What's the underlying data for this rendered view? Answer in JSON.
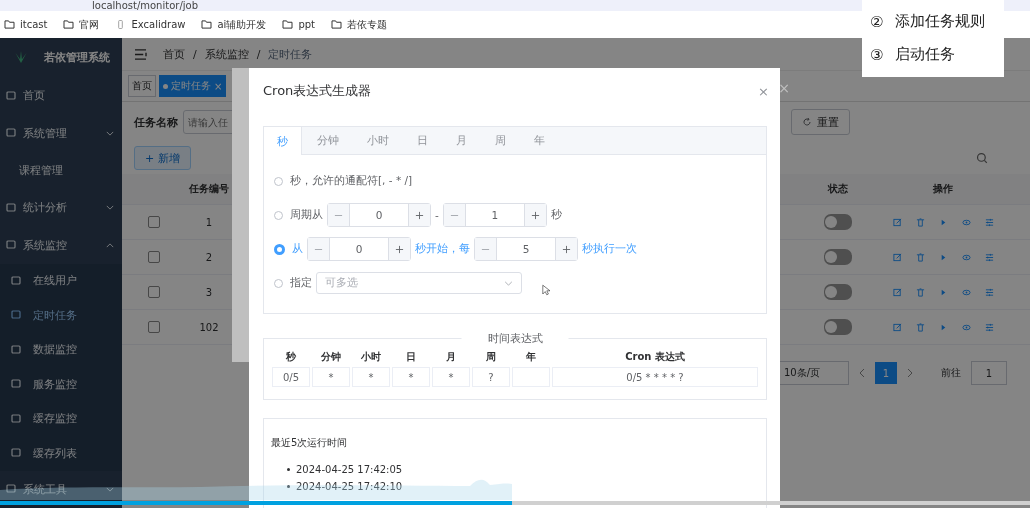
{
  "browser": {
    "url": "localhost/monitor/job",
    "bookmarks": [
      {
        "label": "itcast",
        "kind": "folder"
      },
      {
        "label": "官网",
        "kind": "folder"
      },
      {
        "label": "Excalidraw",
        "kind": "page"
      },
      {
        "label": "ai辅助开发",
        "kind": "folder"
      },
      {
        "label": "ppt",
        "kind": "folder"
      },
      {
        "label": "若依专题",
        "kind": "folder"
      }
    ]
  },
  "steps_popup": {
    "items": [
      {
        "number": "②",
        "label": "添加任务规则"
      },
      {
        "number": "③",
        "label": "启动任务"
      }
    ]
  },
  "sidebar": {
    "title": "若依管理系统",
    "items": [
      {
        "label": "首页",
        "kind": "link",
        "selected": false
      },
      {
        "label": "系统管理",
        "kind": "group",
        "expanded": false
      },
      {
        "label": "课程管理",
        "kind": "plain",
        "selected": false
      },
      {
        "label": "统计分析",
        "kind": "group",
        "expanded": false
      },
      {
        "label": "系统监控",
        "kind": "group",
        "expanded": true,
        "children": [
          {
            "label": "在线用户",
            "selected": false
          },
          {
            "label": "定时任务",
            "selected": true
          },
          {
            "label": "数据监控",
            "selected": false
          },
          {
            "label": "服务监控",
            "selected": false
          },
          {
            "label": "缓存监控",
            "selected": false
          },
          {
            "label": "缓存列表",
            "selected": false
          }
        ]
      },
      {
        "label": "系统工具",
        "kind": "group",
        "expanded": false
      }
    ]
  },
  "navbar": {
    "breadcrumb": [
      "首页",
      "系统监控",
      "定时任务"
    ],
    "separator": "/"
  },
  "tags": [
    {
      "label": "首页",
      "selected": false
    },
    {
      "label": "定时任务",
      "selected": true,
      "close": "×"
    }
  ],
  "search": {
    "label": "任务名称",
    "placeholder": "请输入任"
  },
  "add_button": "+ 新增",
  "reset_button": "重置",
  "table": {
    "columns": [
      "任务编号",
      "状态",
      "操作"
    ],
    "rows": [
      {
        "id": "1",
        "checked": false,
        "on": false
      },
      {
        "id": "2",
        "checked": false,
        "on": false
      },
      {
        "id": "3",
        "checked": false,
        "on": false
      },
      {
        "id": "102",
        "checked": false,
        "on": false
      }
    ]
  },
  "pagination": {
    "page_size": "10条/页",
    "pages": [
      {
        "label": "1",
        "selected": true
      }
    ],
    "goto_label": "前往",
    "goto_value": "1"
  },
  "back_dialog": {
    "close": "×"
  },
  "dialog": {
    "title": "Cron表达式生成器",
    "close": "×",
    "tabs": [
      {
        "label": "秒",
        "selected": true
      },
      {
        "label": "分钟",
        "selected": false
      },
      {
        "label": "小时",
        "selected": false
      },
      {
        "label": "日",
        "selected": false
      },
      {
        "label": "月",
        "selected": false
      },
      {
        "label": "周",
        "selected": false
      },
      {
        "label": "年",
        "selected": false
      }
    ],
    "options": [
      {
        "kind": "text",
        "selected": false,
        "label": "秒，允许的通配符[, - * /]"
      },
      {
        "kind": "range",
        "selected": false,
        "label": "周期从",
        "from": "0",
        "sep": "-",
        "to": "1",
        "unit": "秒"
      },
      {
        "kind": "step",
        "selected": true,
        "label": "从",
        "from": "0",
        "middle": "秒开始，每",
        "to": "5",
        "unit": "秒执行一次"
      },
      {
        "kind": "select",
        "selected": false,
        "label": "指定",
        "placeholder": "可多选"
      }
    ],
    "expression": {
      "title": "时间表达式",
      "columns": [
        "秒",
        "分钟",
        "小时",
        "日",
        "月",
        "周",
        "年",
        "Cron 表达式"
      ],
      "values": [
        "0/5",
        "*",
        "*",
        "*",
        "*",
        "?"
      ],
      "cron": "0/5 * * * * ?"
    },
    "recent": {
      "title": "最近5次运行时间",
      "times": [
        "2024-04-25 17:42:05",
        "2024-04-25 17:42:10"
      ]
    }
  },
  "player": {
    "level": 0.497
  }
}
